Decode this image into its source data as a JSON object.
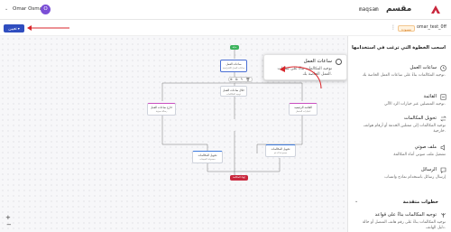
{
  "header": {
    "user_name": "Omar Osman",
    "avatar_initial": "O",
    "brand_en": "maqsam",
    "brand_ar": "مقسم",
    "brand_color": "#c9273d"
  },
  "toolbar": {
    "save_label": "تعيين",
    "flow_name": "omar_test_0ff",
    "flow_badge": "مسودة"
  },
  "canvas": {
    "start_label": "بداية",
    "end_label": "إنهاء المكالمة",
    "nodes": [
      {
        "title": "ساعات العمل",
        "subtitle": "ساعات العمل الافتراضية"
      },
      {
        "title": "خارج ساعات العمل",
        "subtitle": "رسالة صوتية"
      },
      {
        "title": "خلال ساعات العمل",
        "subtitle": "توجيه المكالمات"
      },
      {
        "title": "القائمة الرئيسية",
        "subtitle": "اختيارات المتصل"
      },
      {
        "title": "تحويل المكالمات",
        "subtitle": "مجموعة المبيعات"
      },
      {
        "title": "تحويل المكالمات",
        "subtitle": "مجموعة الدعم"
      }
    ],
    "mini_toolbar": "⊕ ⧉ ✎ 🗑"
  },
  "tooltip": {
    "title": "ساعات العمل",
    "description": "توجيه المكالمات بناءً على ساعات العمل الخاصة بك."
  },
  "panel": {
    "title": "اسحب الخطوة التي ترغب في استخدامها",
    "items": [
      {
        "title": "ساعات العمل",
        "description": "توجيه المكالمات بناءً على ساعات العمل الخاصة بك.",
        "icon": "clock-icon"
      },
      {
        "title": "القائمة",
        "description": "توجيه المتصلين عبر خيارات الرد الآلي.",
        "icon": "menu-icon"
      },
      {
        "title": "تحويل المكالمات",
        "description": "توجيه المكالمات إلى ممثلين الخدمة أو أرقام هواتف خارجية.",
        "icon": "transfer-icon"
      },
      {
        "title": "ملف صوتي",
        "description": "تشغيل ملف صوتي أثناء المكالمة",
        "icon": "audio-icon"
      },
      {
        "title": "الرسائل",
        "description": "إرسال رسائل باستخدام نماذج واتساب",
        "icon": "message-icon"
      }
    ],
    "advanced_title": "خطوات متقدمة",
    "advanced_items": [
      {
        "title": "توجيه المكالمات بناءً على قواعد",
        "description": "توجيه المكالمات بناءً على رقم هاتف المتصل أو حالة دليل الهاتف.",
        "icon": "rules-icon"
      }
    ]
  },
  "zoom": {
    "plus": "+",
    "minus": "−"
  }
}
